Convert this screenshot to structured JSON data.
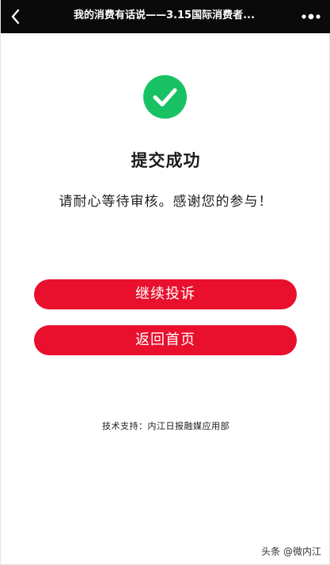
{
  "header": {
    "title": "我的消费有话说——3.15国际消费者...",
    "back_icon": "chevron-left-icon",
    "more_icon": "more-dots-icon"
  },
  "result": {
    "icon": "check-circle-icon",
    "icon_color": "#19c165",
    "title": "提交成功",
    "message": "请耐心等待审核。感谢您的参与！"
  },
  "actions": {
    "continue_label": "继续投诉",
    "home_label": "返回首页",
    "button_color": "#e8102d"
  },
  "footer": {
    "support": "技术支持：内江日报融媒应用部"
  },
  "watermark": {
    "text": "头条 @微内江"
  }
}
